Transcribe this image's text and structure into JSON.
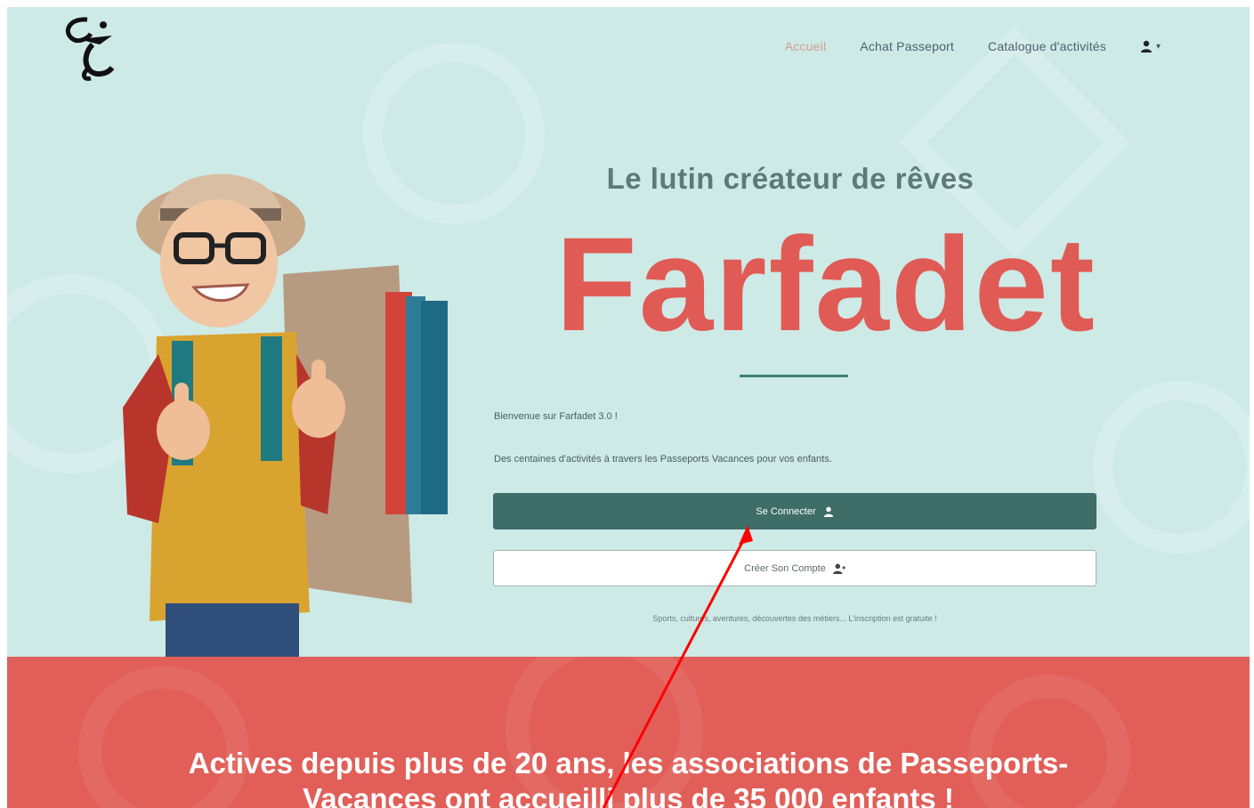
{
  "nav": {
    "home": "Accueil",
    "buy_passport": "Achat Passeport",
    "catalogue": "Catalogue d'activités"
  },
  "hero": {
    "subtitle": "Le lutin créateur de rêves",
    "brand": "Farfadet",
    "welcome": "Bienvenue sur Farfadet 3.0 !",
    "description": "Des centaines d'activités à travers les Passeports Vacances pour vos enfants.",
    "login_label": "Se Connecter",
    "register_label": "Créer Son Compte",
    "note": "Sports, cultures, aventures, découvertes des métiers... L'inscription est gratuite !"
  },
  "band": {
    "line1": "Actives depuis plus de 20 ans, les associations de Passeports-",
    "line2": "Vacances ont accueilli plus de 35 000 enfants !"
  },
  "colors": {
    "hero_bg": "#cdeae7",
    "brand_red": "#e05b55",
    "primary_button": "#3f6d68",
    "annotation_arrow": "#ff0000"
  },
  "icons": [
    "logo-icon",
    "user-icon",
    "caret-down-icon",
    "user-plus-icon"
  ]
}
